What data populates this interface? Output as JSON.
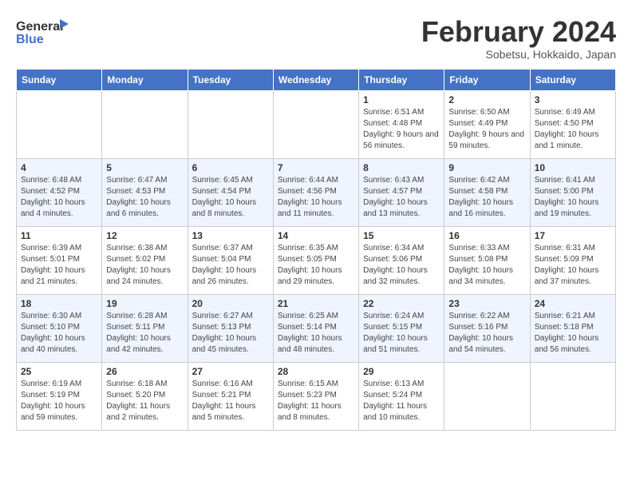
{
  "header": {
    "logo_line1": "General",
    "logo_line2": "Blue",
    "month": "February 2024",
    "location": "Sobetsu, Hokkaido, Japan"
  },
  "days_of_week": [
    "Sunday",
    "Monday",
    "Tuesday",
    "Wednesday",
    "Thursday",
    "Friday",
    "Saturday"
  ],
  "weeks": [
    [
      {
        "day": "",
        "info": ""
      },
      {
        "day": "",
        "info": ""
      },
      {
        "day": "",
        "info": ""
      },
      {
        "day": "",
        "info": ""
      },
      {
        "day": "1",
        "info": "Sunrise: 6:51 AM\nSunset: 4:48 PM\nDaylight: 9 hours and 56 minutes."
      },
      {
        "day": "2",
        "info": "Sunrise: 6:50 AM\nSunset: 4:49 PM\nDaylight: 9 hours and 59 minutes."
      },
      {
        "day": "3",
        "info": "Sunrise: 6:49 AM\nSunset: 4:50 PM\nDaylight: 10 hours and 1 minute."
      }
    ],
    [
      {
        "day": "4",
        "info": "Sunrise: 6:48 AM\nSunset: 4:52 PM\nDaylight: 10 hours and 4 minutes."
      },
      {
        "day": "5",
        "info": "Sunrise: 6:47 AM\nSunset: 4:53 PM\nDaylight: 10 hours and 6 minutes."
      },
      {
        "day": "6",
        "info": "Sunrise: 6:45 AM\nSunset: 4:54 PM\nDaylight: 10 hours and 8 minutes."
      },
      {
        "day": "7",
        "info": "Sunrise: 6:44 AM\nSunset: 4:56 PM\nDaylight: 10 hours and 11 minutes."
      },
      {
        "day": "8",
        "info": "Sunrise: 6:43 AM\nSunset: 4:57 PM\nDaylight: 10 hours and 13 minutes."
      },
      {
        "day": "9",
        "info": "Sunrise: 6:42 AM\nSunset: 4:58 PM\nDaylight: 10 hours and 16 minutes."
      },
      {
        "day": "10",
        "info": "Sunrise: 6:41 AM\nSunset: 5:00 PM\nDaylight: 10 hours and 19 minutes."
      }
    ],
    [
      {
        "day": "11",
        "info": "Sunrise: 6:39 AM\nSunset: 5:01 PM\nDaylight: 10 hours and 21 minutes."
      },
      {
        "day": "12",
        "info": "Sunrise: 6:38 AM\nSunset: 5:02 PM\nDaylight: 10 hours and 24 minutes."
      },
      {
        "day": "13",
        "info": "Sunrise: 6:37 AM\nSunset: 5:04 PM\nDaylight: 10 hours and 26 minutes."
      },
      {
        "day": "14",
        "info": "Sunrise: 6:35 AM\nSunset: 5:05 PM\nDaylight: 10 hours and 29 minutes."
      },
      {
        "day": "15",
        "info": "Sunrise: 6:34 AM\nSunset: 5:06 PM\nDaylight: 10 hours and 32 minutes."
      },
      {
        "day": "16",
        "info": "Sunrise: 6:33 AM\nSunset: 5:08 PM\nDaylight: 10 hours and 34 minutes."
      },
      {
        "day": "17",
        "info": "Sunrise: 6:31 AM\nSunset: 5:09 PM\nDaylight: 10 hours and 37 minutes."
      }
    ],
    [
      {
        "day": "18",
        "info": "Sunrise: 6:30 AM\nSunset: 5:10 PM\nDaylight: 10 hours and 40 minutes."
      },
      {
        "day": "19",
        "info": "Sunrise: 6:28 AM\nSunset: 5:11 PM\nDaylight: 10 hours and 42 minutes."
      },
      {
        "day": "20",
        "info": "Sunrise: 6:27 AM\nSunset: 5:13 PM\nDaylight: 10 hours and 45 minutes."
      },
      {
        "day": "21",
        "info": "Sunrise: 6:25 AM\nSunset: 5:14 PM\nDaylight: 10 hours and 48 minutes."
      },
      {
        "day": "22",
        "info": "Sunrise: 6:24 AM\nSunset: 5:15 PM\nDaylight: 10 hours and 51 minutes."
      },
      {
        "day": "23",
        "info": "Sunrise: 6:22 AM\nSunset: 5:16 PM\nDaylight: 10 hours and 54 minutes."
      },
      {
        "day": "24",
        "info": "Sunrise: 6:21 AM\nSunset: 5:18 PM\nDaylight: 10 hours and 56 minutes."
      }
    ],
    [
      {
        "day": "25",
        "info": "Sunrise: 6:19 AM\nSunset: 5:19 PM\nDaylight: 10 hours and 59 minutes."
      },
      {
        "day": "26",
        "info": "Sunrise: 6:18 AM\nSunset: 5:20 PM\nDaylight: 11 hours and 2 minutes."
      },
      {
        "day": "27",
        "info": "Sunrise: 6:16 AM\nSunset: 5:21 PM\nDaylight: 11 hours and 5 minutes."
      },
      {
        "day": "28",
        "info": "Sunrise: 6:15 AM\nSunset: 5:23 PM\nDaylight: 11 hours and 8 minutes."
      },
      {
        "day": "29",
        "info": "Sunrise: 6:13 AM\nSunset: 5:24 PM\nDaylight: 11 hours and 10 minutes."
      },
      {
        "day": "",
        "info": ""
      },
      {
        "day": "",
        "info": ""
      }
    ]
  ]
}
